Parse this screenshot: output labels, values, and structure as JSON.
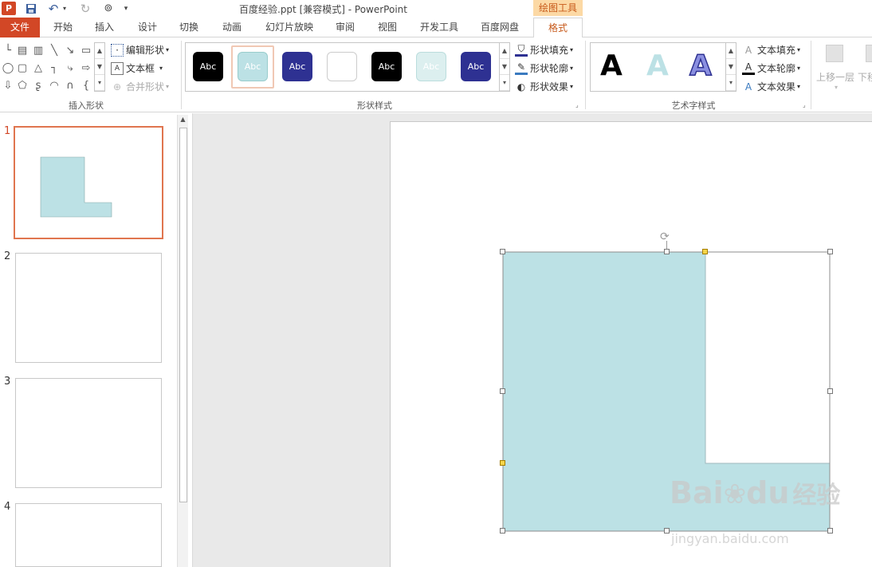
{
  "titlebar": {
    "title": "百度经验.ppt [兼容模式] - PowerPoint",
    "context_label": "绘图工具"
  },
  "tabs": [
    "文件",
    "开始",
    "插入",
    "设计",
    "切换",
    "动画",
    "幻灯片放映",
    "审阅",
    "视图",
    "开发工具",
    "百度网盘",
    "格式"
  ],
  "ribbon": {
    "insert_shapes": {
      "edit_shape": "编辑形状",
      "text_box": "文本框",
      "merge_shapes": "合并形状",
      "label": "插入形状"
    },
    "shape_styles": {
      "swatch_text": "Abc",
      "fill": "形状填充",
      "outline": "形状轮廓",
      "effects": "形状效果",
      "label": "形状样式"
    },
    "wordart_styles": {
      "glyph": "A",
      "text_fill": "文本填充",
      "text_outline": "文本轮廓",
      "text_effects": "文本效果",
      "label": "艺术字样式"
    },
    "arrange": {
      "bring_forward": "上移一层",
      "send_backward": "下移"
    }
  },
  "thumbnails": [
    "1",
    "2",
    "3",
    "4"
  ],
  "watermark": {
    "brand": "Bai",
    "brand2": "du",
    "cn": "经验",
    "url": "jingyan.baidu.com"
  },
  "colors": {
    "accent": "#d24726",
    "shape_fill": "#bce1e5",
    "thumb_selected_border": "#e0754f"
  }
}
